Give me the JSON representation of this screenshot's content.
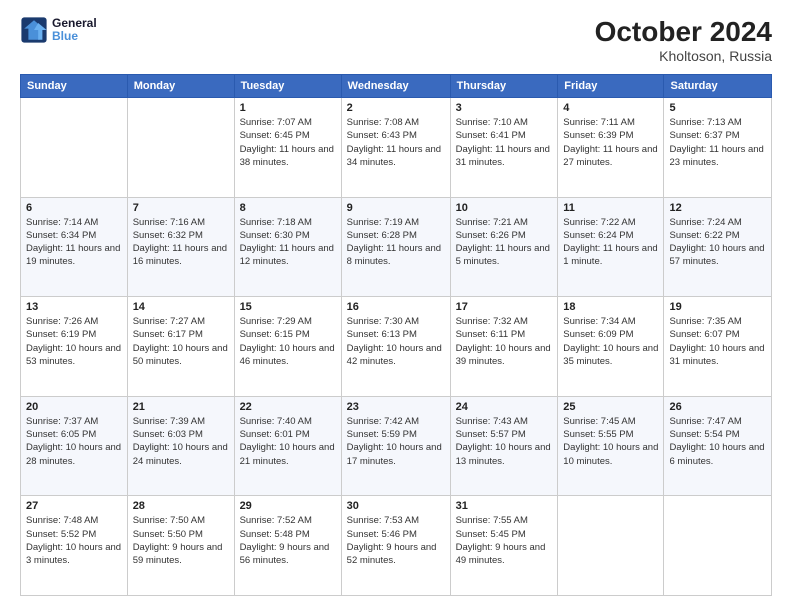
{
  "logo": {
    "line1": "General",
    "line2": "Blue"
  },
  "header": {
    "month": "October 2024",
    "location": "Kholtoson, Russia"
  },
  "weekdays": [
    "Sunday",
    "Monday",
    "Tuesday",
    "Wednesday",
    "Thursday",
    "Friday",
    "Saturday"
  ],
  "rows": [
    [
      {
        "day": "",
        "info": ""
      },
      {
        "day": "",
        "info": ""
      },
      {
        "day": "1",
        "info": "Sunrise: 7:07 AM\nSunset: 6:45 PM\nDaylight: 11 hours and 38 minutes."
      },
      {
        "day": "2",
        "info": "Sunrise: 7:08 AM\nSunset: 6:43 PM\nDaylight: 11 hours and 34 minutes."
      },
      {
        "day": "3",
        "info": "Sunrise: 7:10 AM\nSunset: 6:41 PM\nDaylight: 11 hours and 31 minutes."
      },
      {
        "day": "4",
        "info": "Sunrise: 7:11 AM\nSunset: 6:39 PM\nDaylight: 11 hours and 27 minutes."
      },
      {
        "day": "5",
        "info": "Sunrise: 7:13 AM\nSunset: 6:37 PM\nDaylight: 11 hours and 23 minutes."
      }
    ],
    [
      {
        "day": "6",
        "info": "Sunrise: 7:14 AM\nSunset: 6:34 PM\nDaylight: 11 hours and 19 minutes."
      },
      {
        "day": "7",
        "info": "Sunrise: 7:16 AM\nSunset: 6:32 PM\nDaylight: 11 hours and 16 minutes."
      },
      {
        "day": "8",
        "info": "Sunrise: 7:18 AM\nSunset: 6:30 PM\nDaylight: 11 hours and 12 minutes."
      },
      {
        "day": "9",
        "info": "Sunrise: 7:19 AM\nSunset: 6:28 PM\nDaylight: 11 hours and 8 minutes."
      },
      {
        "day": "10",
        "info": "Sunrise: 7:21 AM\nSunset: 6:26 PM\nDaylight: 11 hours and 5 minutes."
      },
      {
        "day": "11",
        "info": "Sunrise: 7:22 AM\nSunset: 6:24 PM\nDaylight: 11 hours and 1 minute."
      },
      {
        "day": "12",
        "info": "Sunrise: 7:24 AM\nSunset: 6:22 PM\nDaylight: 10 hours and 57 minutes."
      }
    ],
    [
      {
        "day": "13",
        "info": "Sunrise: 7:26 AM\nSunset: 6:19 PM\nDaylight: 10 hours and 53 minutes."
      },
      {
        "day": "14",
        "info": "Sunrise: 7:27 AM\nSunset: 6:17 PM\nDaylight: 10 hours and 50 minutes."
      },
      {
        "day": "15",
        "info": "Sunrise: 7:29 AM\nSunset: 6:15 PM\nDaylight: 10 hours and 46 minutes."
      },
      {
        "day": "16",
        "info": "Sunrise: 7:30 AM\nSunset: 6:13 PM\nDaylight: 10 hours and 42 minutes."
      },
      {
        "day": "17",
        "info": "Sunrise: 7:32 AM\nSunset: 6:11 PM\nDaylight: 10 hours and 39 minutes."
      },
      {
        "day": "18",
        "info": "Sunrise: 7:34 AM\nSunset: 6:09 PM\nDaylight: 10 hours and 35 minutes."
      },
      {
        "day": "19",
        "info": "Sunrise: 7:35 AM\nSunset: 6:07 PM\nDaylight: 10 hours and 31 minutes."
      }
    ],
    [
      {
        "day": "20",
        "info": "Sunrise: 7:37 AM\nSunset: 6:05 PM\nDaylight: 10 hours and 28 minutes."
      },
      {
        "day": "21",
        "info": "Sunrise: 7:39 AM\nSunset: 6:03 PM\nDaylight: 10 hours and 24 minutes."
      },
      {
        "day": "22",
        "info": "Sunrise: 7:40 AM\nSunset: 6:01 PM\nDaylight: 10 hours and 21 minutes."
      },
      {
        "day": "23",
        "info": "Sunrise: 7:42 AM\nSunset: 5:59 PM\nDaylight: 10 hours and 17 minutes."
      },
      {
        "day": "24",
        "info": "Sunrise: 7:43 AM\nSunset: 5:57 PM\nDaylight: 10 hours and 13 minutes."
      },
      {
        "day": "25",
        "info": "Sunrise: 7:45 AM\nSunset: 5:55 PM\nDaylight: 10 hours and 10 minutes."
      },
      {
        "day": "26",
        "info": "Sunrise: 7:47 AM\nSunset: 5:54 PM\nDaylight: 10 hours and 6 minutes."
      }
    ],
    [
      {
        "day": "27",
        "info": "Sunrise: 7:48 AM\nSunset: 5:52 PM\nDaylight: 10 hours and 3 minutes."
      },
      {
        "day": "28",
        "info": "Sunrise: 7:50 AM\nSunset: 5:50 PM\nDaylight: 9 hours and 59 minutes."
      },
      {
        "day": "29",
        "info": "Sunrise: 7:52 AM\nSunset: 5:48 PM\nDaylight: 9 hours and 56 minutes."
      },
      {
        "day": "30",
        "info": "Sunrise: 7:53 AM\nSunset: 5:46 PM\nDaylight: 9 hours and 52 minutes."
      },
      {
        "day": "31",
        "info": "Sunrise: 7:55 AM\nSunset: 5:45 PM\nDaylight: 9 hours and 49 minutes."
      },
      {
        "day": "",
        "info": ""
      },
      {
        "day": "",
        "info": ""
      }
    ]
  ]
}
